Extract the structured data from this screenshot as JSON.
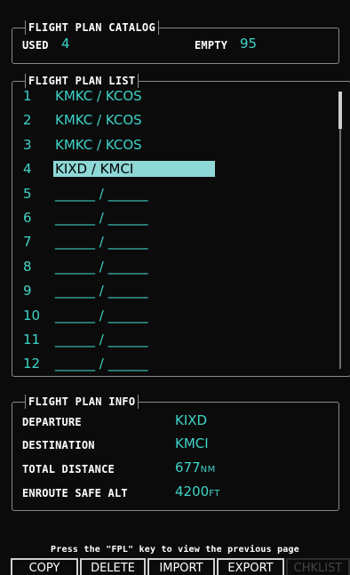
{
  "catalog": {
    "title": "FLIGHT PLAN CATALOG",
    "used_label": "USED",
    "used_value": "4",
    "empty_label": "EMPTY",
    "empty_value": "95"
  },
  "list": {
    "title": "FLIGHT PLAN LIST",
    "rows": [
      {
        "num": "1",
        "route": "KMKC / KCOS"
      },
      {
        "num": "2",
        "route": "KMKC / KCOS"
      },
      {
        "num": "3",
        "route": "KMKC / KCOS"
      },
      {
        "num": "4",
        "route": "KIXD / KMCI"
      },
      {
        "num": "5",
        "route": "______ / ______"
      },
      {
        "num": "6",
        "route": "______ / ______"
      },
      {
        "num": "7",
        "route": "______ / ______"
      },
      {
        "num": "8",
        "route": "______ / ______"
      },
      {
        "num": "9",
        "route": "______ / ______"
      },
      {
        "num": "10",
        "route": "______ / ______"
      },
      {
        "num": "11",
        "route": "______ / ______"
      },
      {
        "num": "12",
        "route": "______ / ______"
      }
    ],
    "selected_index": 3
  },
  "info": {
    "title": "FLIGHT PLAN INFO",
    "departure_label": "DEPARTURE",
    "departure_value": "KIXD",
    "destination_label": "DESTINATION",
    "destination_value": "KMCI",
    "distance_label": "TOTAL DISTANCE",
    "distance_value": "677",
    "distance_unit": "NM",
    "alt_label": "ENROUTE SAFE ALT",
    "alt_value": "4200",
    "alt_unit": "FT"
  },
  "footer": {
    "message": "Press the \"FPL\" key to view the previous page"
  },
  "softkeys": [
    {
      "label": "COPY",
      "enabled": true
    },
    {
      "label": "DELETE",
      "enabled": true
    },
    {
      "label": "IMPORT",
      "enabled": true
    },
    {
      "label": "EXPORT",
      "enabled": true
    },
    {
      "label": "CHKLIST",
      "enabled": false
    }
  ],
  "colors": {
    "value_cyan": "#3fd4c8",
    "selection_bg": "#8ed8d6",
    "border_gray": "#8a8a8a"
  }
}
